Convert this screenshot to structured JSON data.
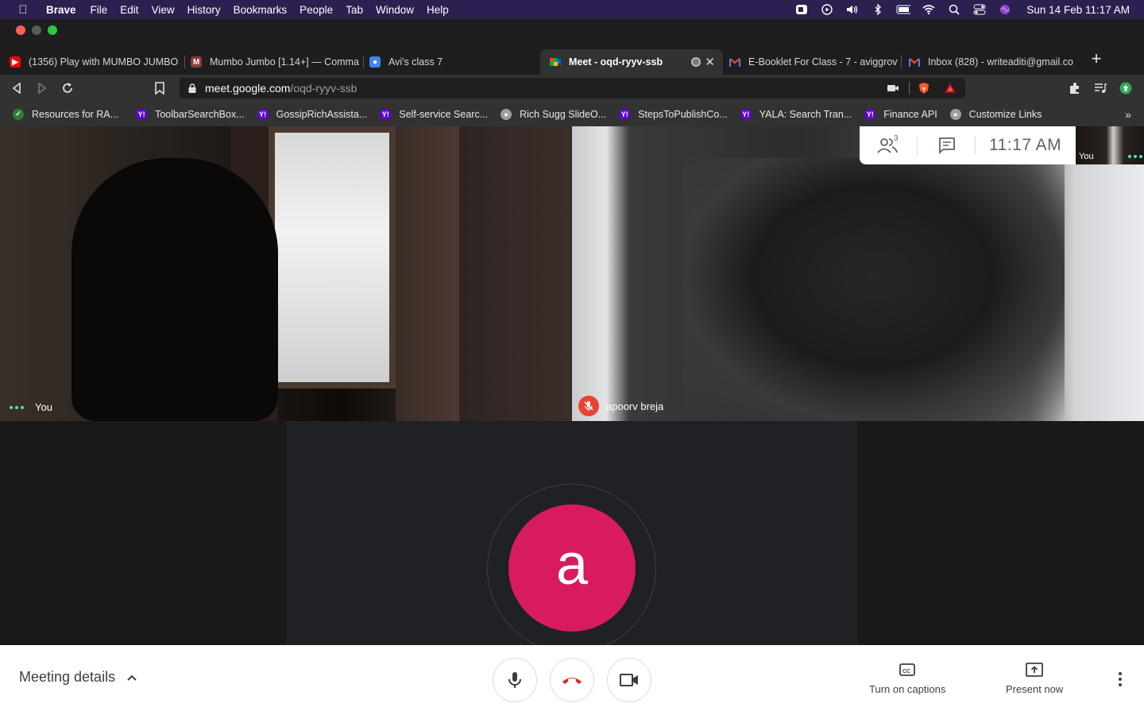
{
  "menubar": {
    "app": "Brave",
    "items": [
      "File",
      "Edit",
      "View",
      "History",
      "Bookmarks",
      "People",
      "Tab",
      "Window",
      "Help"
    ],
    "clock": "Sun 14 Feb  11:17 AM"
  },
  "tabs": [
    {
      "title": "(1356) Play with MUMBO JUMBO",
      "favicon": "youtube-icon",
      "color": "#ff0000"
    },
    {
      "title": "Mumbo Jumbo [1.14+] — Comma",
      "favicon": "gamepedia-icon",
      "color": "#8b3a3a"
    },
    {
      "title": "Avi's class 7",
      "favicon": "classroom-icon",
      "color": "#1e8e3e"
    },
    {
      "title": "Meet - oqd-ryyv-ssb",
      "favicon": "meet-icon",
      "color": "#00897b",
      "active": true
    },
    {
      "title": "E-Booklet For Class - 7 - aviggrov",
      "favicon": "gmail-icon",
      "color": "#ea4335"
    },
    {
      "title": "Inbox (828) - writeaditi@gmail.co",
      "favicon": "gmail-icon",
      "color": "#ea4335"
    }
  ],
  "address": {
    "host": "meet.google.com",
    "path": "/oqd-ryyv-ssb"
  },
  "bookmarks": [
    {
      "label": "Resources for RA...",
      "icon": "globe-green-icon",
      "color": "#2e7d32"
    },
    {
      "label": "ToolbarSearchBox...",
      "icon": "yahoo-icon",
      "color": "#6001d2"
    },
    {
      "label": "GossipRichAssista...",
      "icon": "yahoo-icon",
      "color": "#6001d2"
    },
    {
      "label": "Self-service Searc...",
      "icon": "yahoo-icon",
      "color": "#6001d2"
    },
    {
      "label": "Rich Sugg SlideO...",
      "icon": "globe-icon",
      "color": "#9e9e9e"
    },
    {
      "label": "StepsToPublishCo...",
      "icon": "yahoo-icon",
      "color": "#6001d2"
    },
    {
      "label": "YALA: Search Tran...",
      "icon": "yahoo-icon",
      "color": "#6001d2"
    },
    {
      "label": "Finance API",
      "icon": "yahoo-icon",
      "color": "#6001d2"
    },
    {
      "label": "Customize Links",
      "icon": "globe-icon",
      "color": "#9e9e9e"
    }
  ],
  "meet": {
    "participants_count": "3",
    "time": "11:17  AM",
    "self_label": "You",
    "left_tile_name": "You",
    "right_tile_name": "apoorv breja",
    "avatar_letter": "a",
    "avatar_color": "#d81b60"
  },
  "bottombar": {
    "meeting_details": "Meeting details",
    "captions": "Turn on captions",
    "present": "Present now"
  }
}
